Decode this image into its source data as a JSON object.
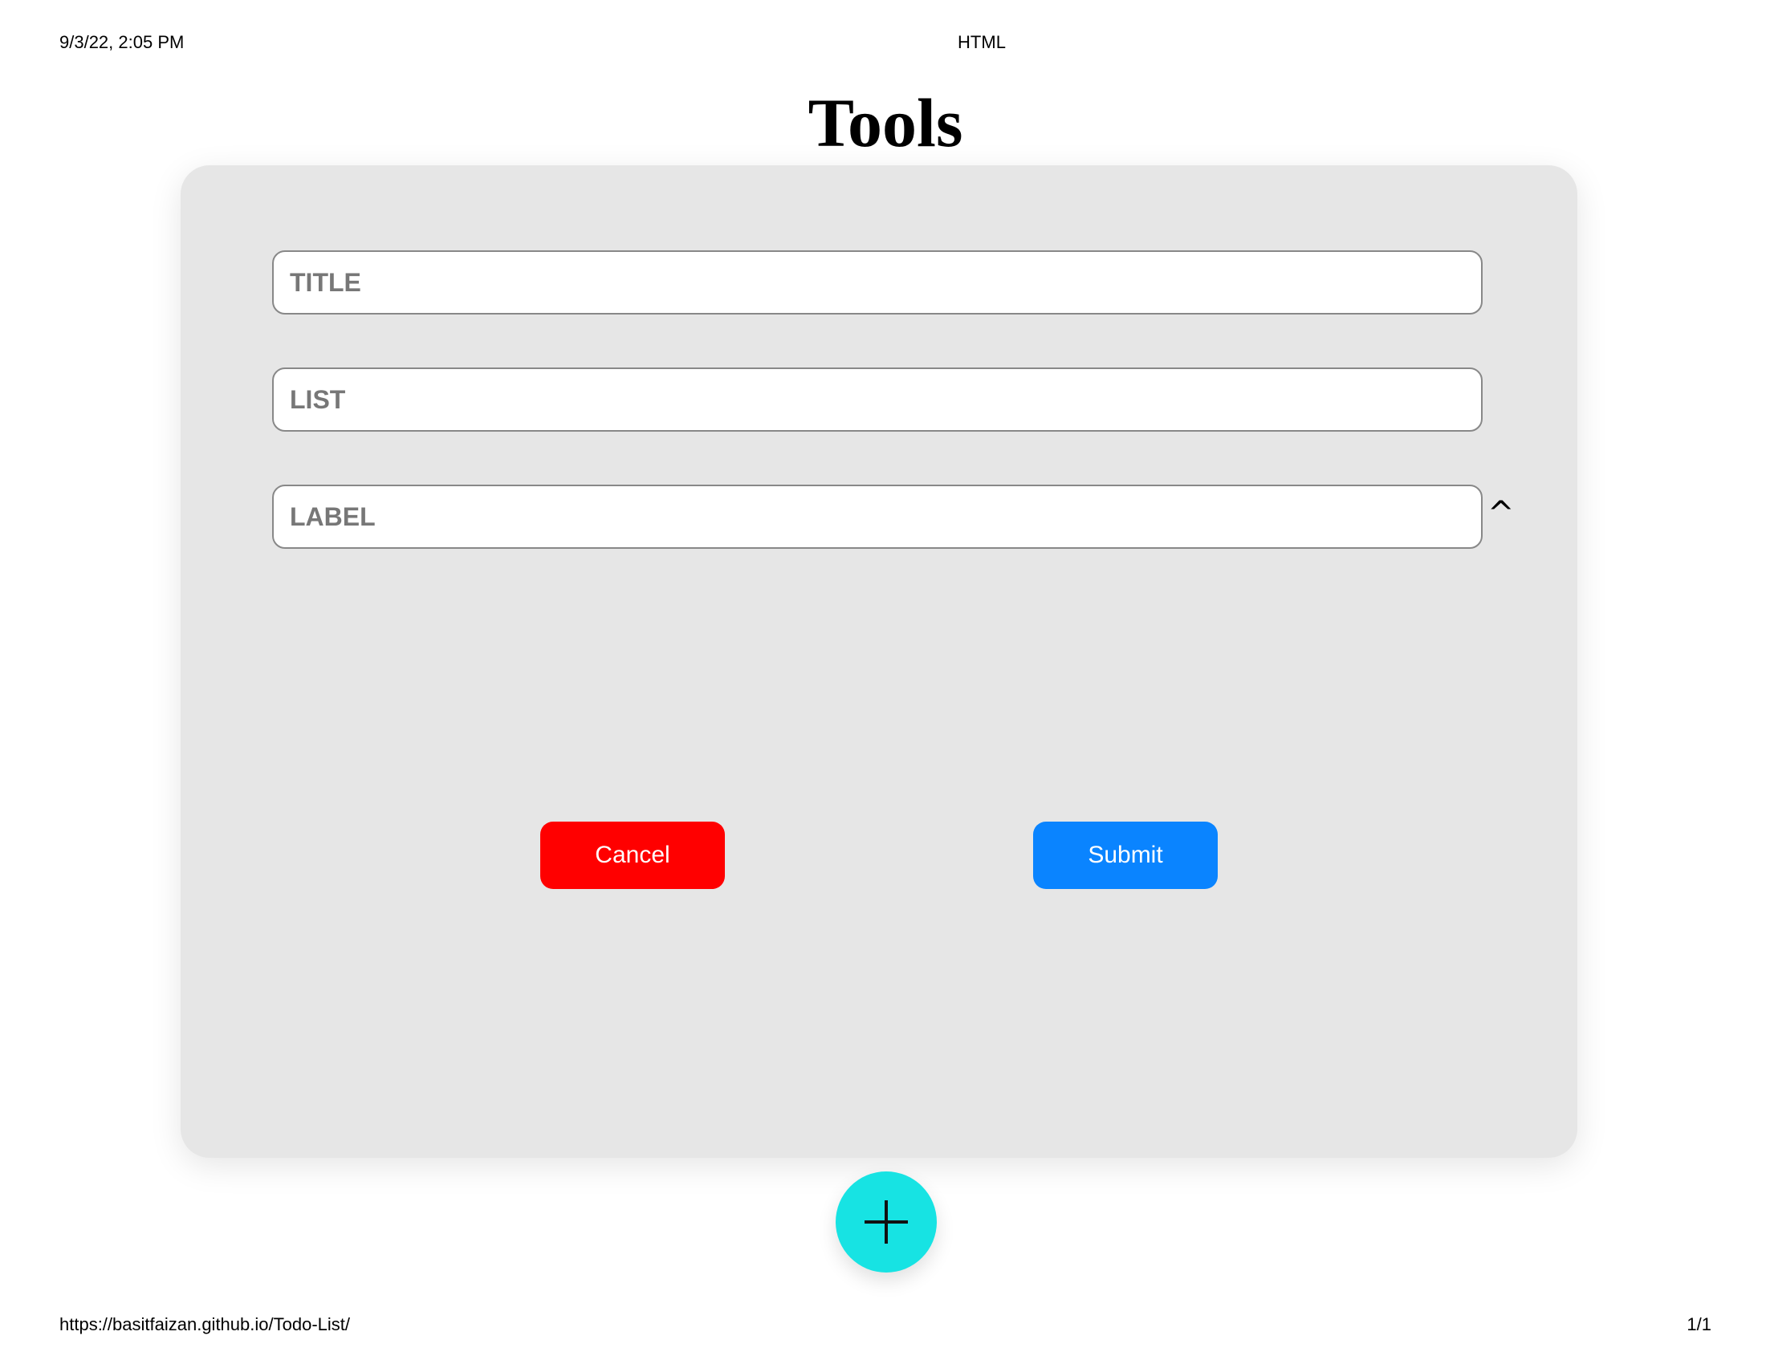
{
  "print_header": {
    "datetime": "9/3/22, 2:05 PM",
    "document_title": "HTML"
  },
  "page": {
    "title": "Tools"
  },
  "form": {
    "title_placeholder": "TITLE",
    "title_value": "",
    "list_placeholder": "LIST",
    "list_value": "",
    "label_placeholder": "LABEL",
    "label_value": "",
    "label_toggle_glyph": "^",
    "cancel_label": "Cancel",
    "submit_label": "Submit"
  },
  "fab": {
    "icon": "plus-icon"
  },
  "print_footer": {
    "url": "https://basitfaizan.github.io/Todo-List/",
    "page_number": "1/1"
  },
  "colors": {
    "card_background": "#e6e6e6",
    "cancel_button": "#ff0000",
    "submit_button": "#0a84ff",
    "fab_background": "#17e3e3"
  }
}
